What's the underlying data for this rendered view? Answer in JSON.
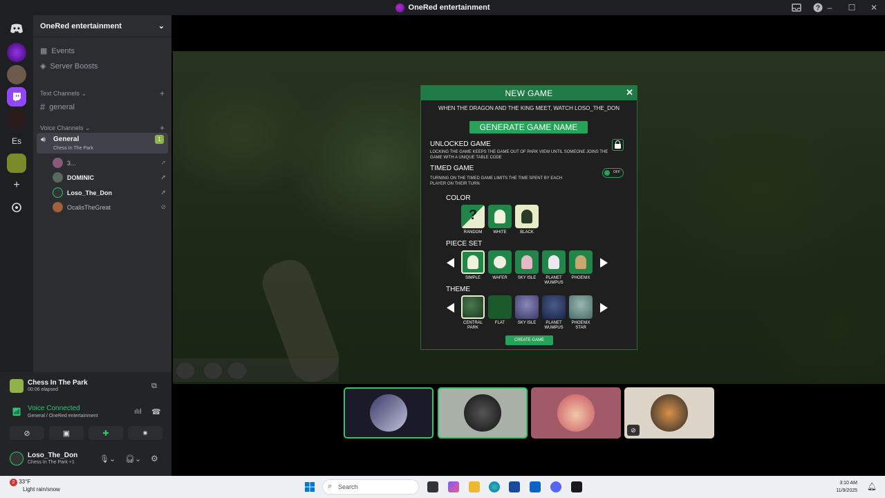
{
  "window": {
    "title": "OneRed entertainment"
  },
  "sidebar": {
    "server_name": "OneRed entertainment",
    "rail_server_abbrev": "Es",
    "nav": [
      {
        "label": "Events"
      },
      {
        "label": "Server Boosts"
      }
    ],
    "text_category": "Text Channels",
    "text_channels": [
      {
        "label": "general"
      }
    ],
    "voice_category": "Voice Channels",
    "voice_channel": {
      "name": "General",
      "activity": "Chess In The Park",
      "user_count": "1"
    },
    "voice_users": [
      {
        "name": "3..."
      },
      {
        "name": "DOMINIC"
      },
      {
        "name": "Loso_The_Don"
      },
      {
        "name": "OcalisTheGreat"
      }
    ]
  },
  "panel": {
    "activity_name": "Chess In The Park",
    "activity_elapsed": "00:06 elapsed",
    "voice_status": "Voice Connected",
    "voice_location": "General / OneRed entertainment",
    "username": "Loso_The_Don",
    "user_activity": "Chess In The Park +1"
  },
  "modal": {
    "title": "NEW GAME",
    "close": "✕",
    "game_name": "WHEN THE DRAGON AND THE KING MEET, WATCH LOSO_THE_DON",
    "generate_label": "GENERATE GAME NAME",
    "unlocked": {
      "title": "UNLOCKED GAME",
      "desc": "LOCKING THE GAME KEEPS THE GAME OUT OF PARK VIEW UNTIL SOMEONE JOINS THE GAME WITH A UNIQUE TABLE CODE"
    },
    "timed": {
      "title": "TIMED GAME",
      "desc": "TURNING ON THE TIMED GAME LIMITS THE TIME SPENT BY EACH PLAYER ON THEIR TURN",
      "toggle_label": "OFF"
    },
    "color_title": "COLOR",
    "color_options": [
      {
        "label": "RANDOM",
        "glyph": "?"
      },
      {
        "label": "WHITE"
      },
      {
        "label": "BLACK"
      }
    ],
    "piece_title": "PIECE SET",
    "piece_options": [
      {
        "label": "SIMPLE"
      },
      {
        "label": "WAFER"
      },
      {
        "label": "SKY ISLE"
      },
      {
        "label": "PLANET WUMPUS"
      },
      {
        "label": "PHOENIX"
      }
    ],
    "theme_title": "THEME",
    "theme_options": [
      {
        "label": "CENTRAL PARK"
      },
      {
        "label": "FLAT"
      },
      {
        "label": "SKY ISLE"
      },
      {
        "label": "PLANET WUMPUS"
      },
      {
        "label": "PHOENIX STAR"
      }
    ],
    "create_label": "CREATE GAME"
  },
  "taskbar": {
    "weather_badge": "2",
    "temperature": "33°F",
    "weather": "Light rain/snow",
    "search_placeholder": "Search",
    "time": "3:10 AM",
    "date": "11/9/2025"
  },
  "colors": {
    "accent_green": "#26a358",
    "modal_header": "#1f7a45",
    "voice_connected": "#2dc770",
    "discord_bg": "#2b2d31"
  }
}
